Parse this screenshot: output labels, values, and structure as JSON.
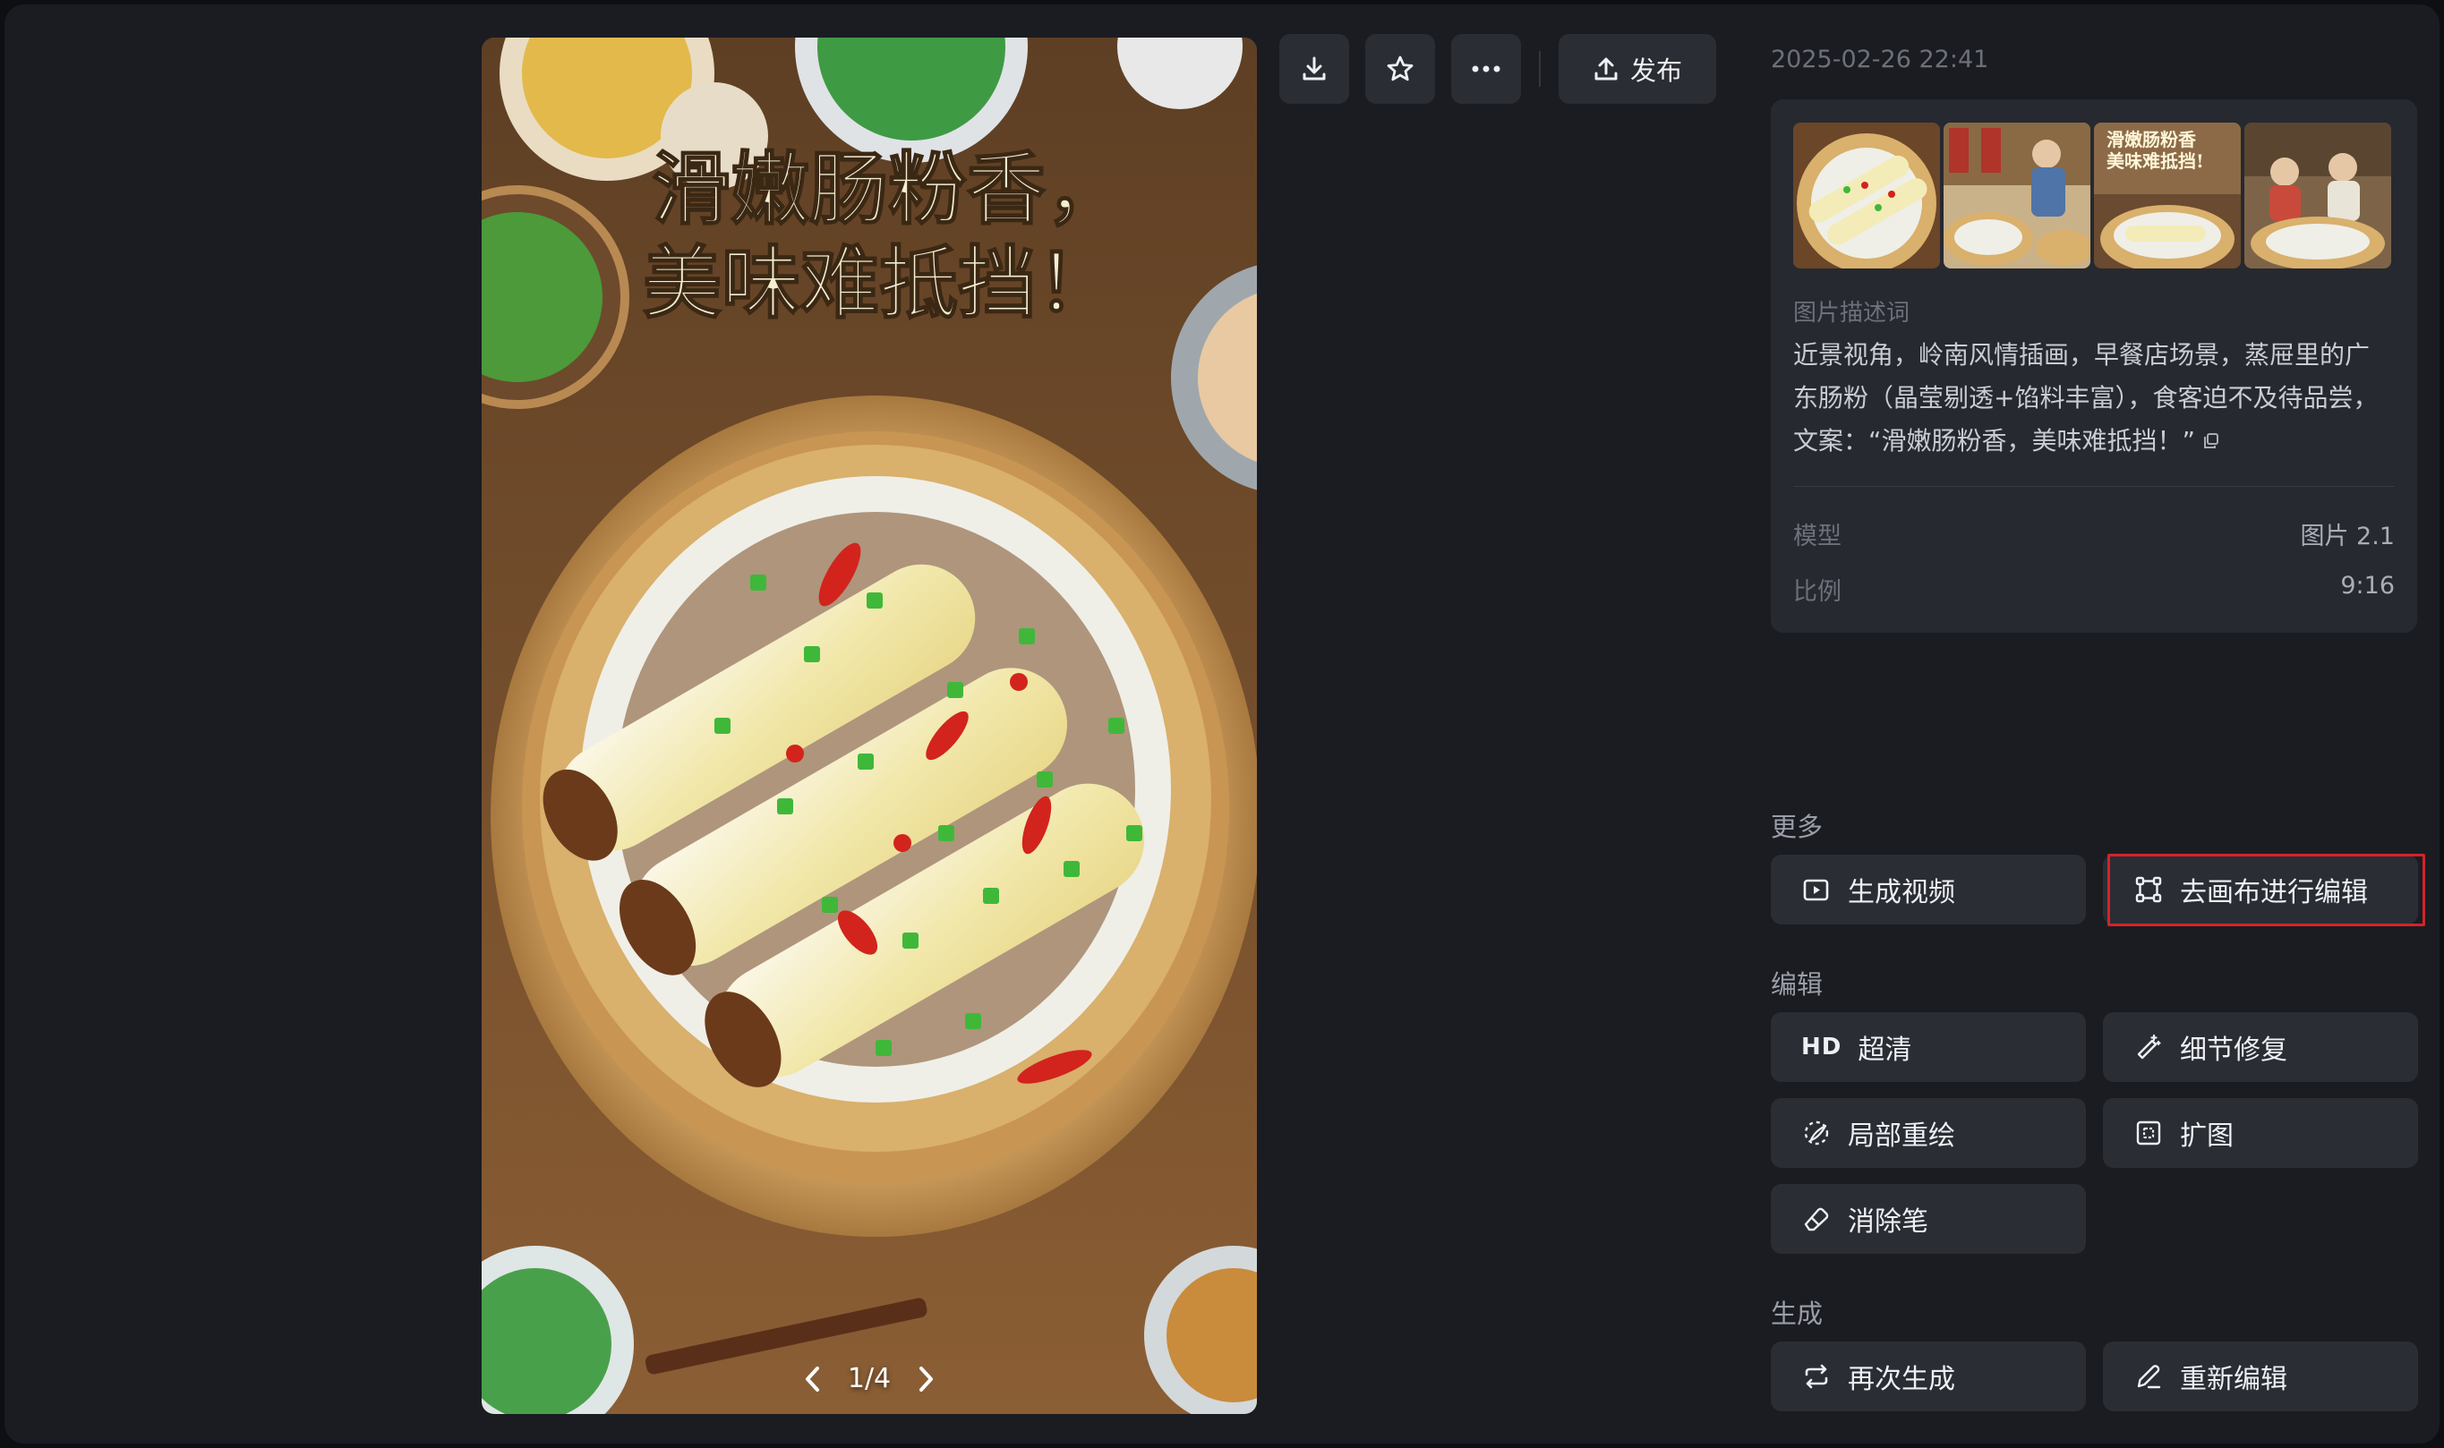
{
  "toolbar": {
    "download_icon": "download-icon",
    "favorite_icon": "star-icon",
    "more_icon": "more-icon",
    "publish_label": "发布"
  },
  "main_image": {
    "headline_line1": "滑嫩肠粉香，",
    "headline_line2": "美味难抵挡！",
    "pager": "1/4"
  },
  "info": {
    "timestamp": "2025-02-26 22:41",
    "thumbnails": [
      {
        "alt": "rice-roll-thumbnail",
        "caption": ""
      },
      {
        "alt": "breakfast-shop-thumbnail",
        "caption": ""
      },
      {
        "alt": "poster-thumbnail",
        "caption_line1": "滑嫩肠粉香",
        "caption_line2": "美味难抵挡!"
      },
      {
        "alt": "diners-thumbnail",
        "caption": ""
      }
    ],
    "description_label": "图片描述词",
    "description_lines": [
      "近景视角，岭南风情插画，早餐店场景，蒸屉里的广",
      "东肠粉（晶莹剔透+馅料丰富），食客迫不及待品尝，",
      "文案：“滑嫩肠粉香，美味难抵挡！”"
    ],
    "model_label": "模型",
    "model_value": "图片 2.1",
    "ratio_label": "比例",
    "ratio_value": "9:16"
  },
  "sections": {
    "more": {
      "title": "更多",
      "generate_video": "生成视频",
      "canvas_edit": "去画布进行编辑"
    },
    "edit": {
      "title": "编辑",
      "hd_badge": "HD",
      "upscale": "超清",
      "detail_fix": "细节修复",
      "inpaint": "局部重绘",
      "outpaint": "扩图",
      "eraser": "消除笔"
    },
    "generate": {
      "title": "生成",
      "regenerate": "再次生成",
      "re_edit": "重新编辑"
    }
  },
  "colors": {
    "background": "#1a1c22",
    "card": "#262930",
    "button": "#2a2d34",
    "highlight": "#d3232a"
  }
}
